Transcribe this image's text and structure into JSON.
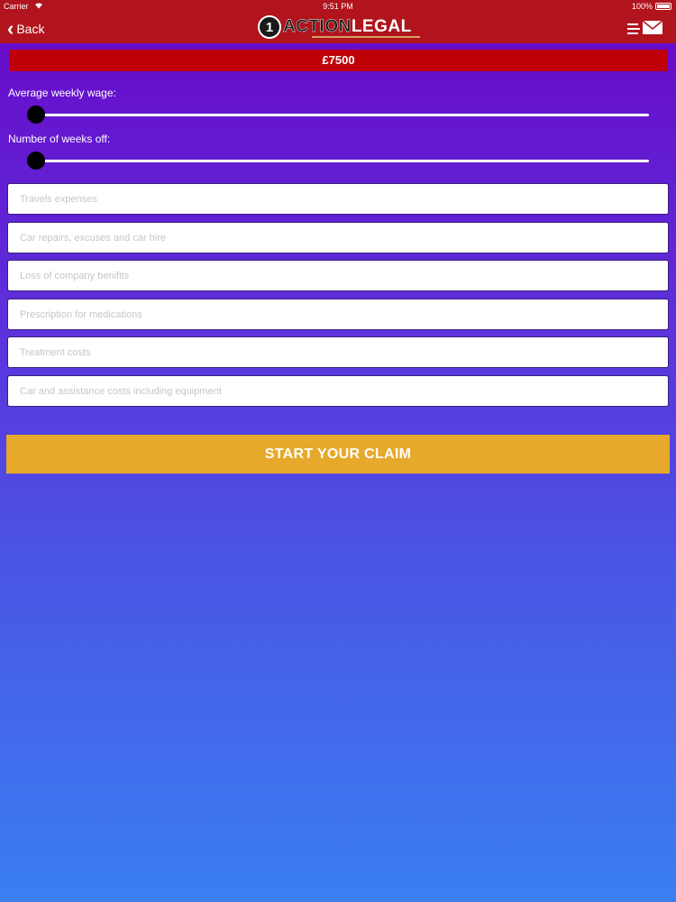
{
  "status_bar": {
    "carrier": "Carrier",
    "wifi_icon": "wifi-icon",
    "time": "9:51 PM",
    "battery": "100%"
  },
  "nav": {
    "back_label": "Back",
    "back_icon": "chevron-left-icon",
    "logo": {
      "badge": "1",
      "word1": "ACTION",
      "word2": "LEGAL"
    },
    "menu_icon": "mail-menu-icon"
  },
  "total": {
    "value": "£7500"
  },
  "sliders": [
    {
      "label": "Average weekly wage:",
      "value": 0
    },
    {
      "label": "Number of weeks off:",
      "value": 0
    }
  ],
  "fields": [
    {
      "placeholder": "Travels expenses",
      "value": ""
    },
    {
      "placeholder": "Car repairs, excuses and car hire",
      "value": ""
    },
    {
      "placeholder": "Loss of company benifits",
      "value": ""
    },
    {
      "placeholder": "Prescription for medications",
      "value": ""
    },
    {
      "placeholder": "Treatment costs",
      "value": ""
    },
    {
      "placeholder": "Car and assistance costs including equipment",
      "value": ""
    }
  ],
  "cta": {
    "label": "START YOUR CLAIM"
  },
  "colors": {
    "header": "#b1141c",
    "total_bar": "#bf0107",
    "cta": "#e7a92b",
    "gradient_top": "#6a06c8",
    "gradient_bottom": "#3a7ff2"
  }
}
